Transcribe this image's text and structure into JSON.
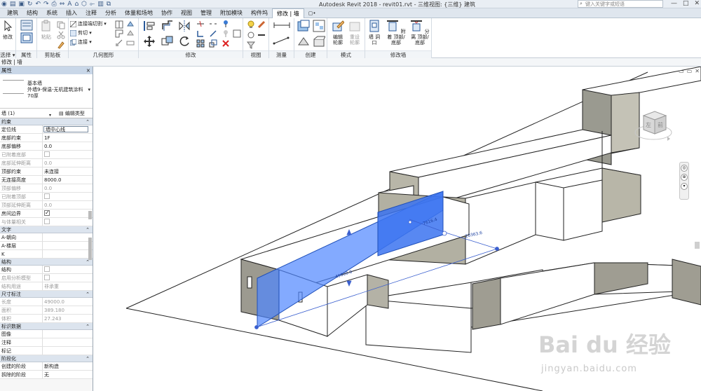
{
  "titlebar": {
    "title": "Autodesk Revit 2018 -    revit01.rvt - 三维视图: {三维} 建筑",
    "search_placeholder": "键入关键字或短语"
  },
  "tabs": [
    {
      "label": "建筑"
    },
    {
      "label": "结构"
    },
    {
      "label": "系统"
    },
    {
      "label": "插入"
    },
    {
      "label": "注释"
    },
    {
      "label": "分析"
    },
    {
      "label": "体量和场地"
    },
    {
      "label": "协作"
    },
    {
      "label": "视图"
    },
    {
      "label": "管理"
    },
    {
      "label": "附加模块"
    },
    {
      "label": "构件坞"
    },
    {
      "label": "修改 | 墙",
      "active": true
    },
    {
      "label": "▢•"
    }
  ],
  "ribbon": {
    "select_panel": {
      "modify_label": "修改",
      "panel_label": "选择 ▾"
    },
    "properties_panel": {
      "panel_label": "属性"
    },
    "clipboard_panel": {
      "paste_label": "粘贴",
      "panel_label": "剪贴板"
    },
    "geometry_panel": {
      "cope_label": "连接端切割 ▾",
      "cut_label": "剪切 ▾",
      "join_label": "连接 ▾",
      "panel_label": "几何图形"
    },
    "modify_panel": {
      "panel_label": "修改"
    },
    "view_panel": {
      "panel_label": "视图"
    },
    "measure_panel": {
      "panel_label": "测量"
    },
    "create_panel": {
      "panel_label": "创建"
    },
    "mode_panel": {
      "edit_profile_label": "编辑 轮廓",
      "reset_profile_label": "重设 轮廓",
      "panel_label": "模式"
    },
    "modify_wall_panel": {
      "wall_opening_label": "墙 洞口",
      "attach_label": "附着 顶部/底部",
      "detach_label": "分离 顶部/底部",
      "panel_label": "修改墙"
    }
  },
  "optbar": {
    "text": "修改 | 墙"
  },
  "properties": {
    "header": "属性",
    "close": "×",
    "type_name_line1": "基本墙",
    "type_name_line2": "外墙9-保温-无机建筑涂料",
    "type_name_line3": "70厚",
    "instance_selector": "墙 (1)",
    "edit_type": "编辑类型",
    "groups": [
      {
        "name": "约束",
        "rows": [
          {
            "key": "定位线",
            "value": "墙中心线",
            "boxed": true
          },
          {
            "key": "底部约束",
            "value": "1F"
          },
          {
            "key": "底部偏移",
            "value": "0.0"
          },
          {
            "key": "已附着底部",
            "value": "",
            "checkbox": "off",
            "dim": true
          },
          {
            "key": "底部延伸距离",
            "value": "0.0",
            "dim": true
          },
          {
            "key": "顶部约束",
            "value": "未连接"
          },
          {
            "key": "无连接高度",
            "value": "8000.0"
          },
          {
            "key": "顶部偏移",
            "value": "0.0",
            "dim": true
          },
          {
            "key": "已附着顶部",
            "value": "",
            "checkbox": "off",
            "dim": true
          },
          {
            "key": "顶部延伸距离",
            "value": "0.0",
            "dim": true
          },
          {
            "key": "房间边界",
            "value": "",
            "checkbox": "on"
          },
          {
            "key": "与体量相关",
            "value": "",
            "checkbox": "off",
            "dim": true
          }
        ]
      },
      {
        "name": "文字",
        "rows": [
          {
            "key": "A-朝向",
            "value": ""
          },
          {
            "key": "A-楼层",
            "value": ""
          },
          {
            "key": "K",
            "value": ""
          }
        ]
      },
      {
        "name": "结构",
        "rows": [
          {
            "key": "结构",
            "value": "",
            "checkbox": "off"
          },
          {
            "key": "启用分析模型",
            "value": "",
            "checkbox": "off",
            "dim": true
          },
          {
            "key": "结构用途",
            "value": "非承重",
            "dim": true
          }
        ]
      },
      {
        "name": "尺寸标注",
        "rows": [
          {
            "key": "长度",
            "value": "49000.0",
            "dim": true
          },
          {
            "key": "面积",
            "value": "389.180",
            "dim": true
          },
          {
            "key": "体积",
            "value": "27.243",
            "dim": true
          }
        ]
      },
      {
        "name": "标识数据",
        "rows": [
          {
            "key": "图像",
            "value": ""
          },
          {
            "key": "注释",
            "value": ""
          },
          {
            "key": "标记",
            "value": ""
          }
        ]
      },
      {
        "name": "阶段化",
        "rows": [
          {
            "key": "创建的阶段",
            "value": "新构造"
          },
          {
            "key": "拆除的阶段",
            "value": "无"
          }
        ]
      }
    ]
  },
  "viewport": {
    "dim_1": "7616.4",
    "dim_2": "10363.6",
    "dim_3": "49000.0",
    "viewcube_left": "左",
    "viewcube_front": "前",
    "watermark_1": "Bai du 经验",
    "watermark_2": "jingyan.baidu.com"
  },
  "colors": {
    "selection": "#4f86ff",
    "ribbon_tab_active": "#ffffff"
  }
}
